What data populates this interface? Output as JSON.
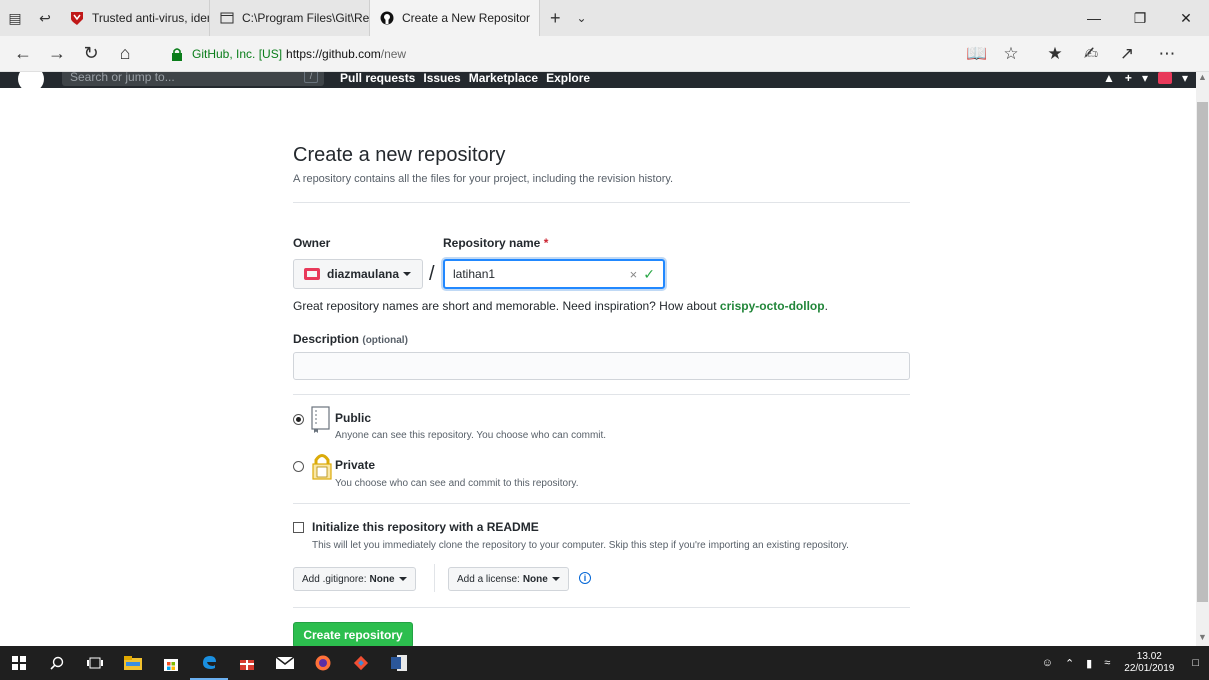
{
  "browser": {
    "tabs": [
      {
        "label": "Trusted anti-virus, identity n"
      },
      {
        "label": "C:\\Program Files\\Git\\Releas"
      },
      {
        "label": "Create a New Repositor"
      }
    ],
    "site_identity": "GitHub, Inc. [US]",
    "url_host": "https://github.com",
    "url_path": "/new"
  },
  "gh_header": {
    "search_placeholder": "Search or jump to...",
    "slash_key": "/",
    "nav": [
      "Pull requests",
      "Issues",
      "Marketplace",
      "Explore"
    ],
    "plus": "+"
  },
  "form": {
    "title": "Create a new repository",
    "subtitle": "A repository contains all the files for your project, including the revision history.",
    "owner_label": "Owner",
    "repo_label": "Repository name",
    "required_mark": "*",
    "owner_value": "diazmaulana",
    "separator": "/",
    "repo_value": "latihan1",
    "hint_prefix": "Great repository names are short and memorable. Need inspiration? How about ",
    "hint_suggestion": "crispy-octo-dollop",
    "hint_suffix": ".",
    "description_label": "Description",
    "description_optional": "(optional)",
    "description_value": "",
    "visibility": [
      {
        "title": "Public",
        "note": "Anyone can see this repository. You choose who can commit.",
        "selected": true
      },
      {
        "title": "Private",
        "note": "You choose who can see and commit to this repository.",
        "selected": false
      }
    ],
    "readme_title": "Initialize this repository with a README",
    "readme_note": "This will let you immediately clone the repository to your computer. Skip this step if you're importing an existing repository.",
    "readme_checked": false,
    "gitignore_label": "Add .gitignore:",
    "gitignore_value": "None",
    "license_label": "Add a license:",
    "license_value": "None",
    "info_glyph": "i",
    "create_label": "Create repository"
  },
  "taskbar": {
    "time": "13.02",
    "date": "22/01/2019"
  },
  "colors": {
    "accent_green": "#2cbe4e",
    "link_green": "#22863a",
    "focus_blue": "#2188ff",
    "header_dark": "#24292e"
  }
}
